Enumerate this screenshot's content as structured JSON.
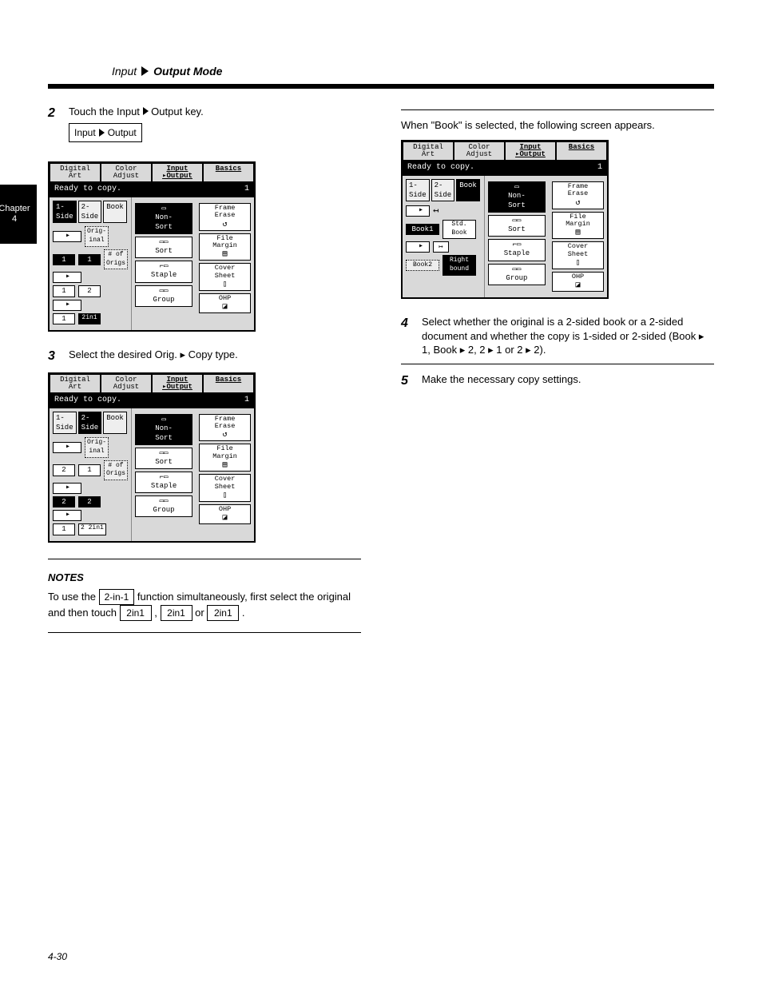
{
  "header": {
    "prefix": "Input",
    "suffix": "Output Mode"
  },
  "sidetab": {
    "line1": "Chapter",
    "line2": "4"
  },
  "left": {
    "step2": {
      "num": "2",
      "text": "Touch the",
      "tail": " key.",
      "key": "Output",
      "keyPrefix": "Input"
    },
    "panel1_caption": "",
    "step3": {
      "num": "3",
      "text": "Select the desired Orig. ▸ Copy type."
    },
    "noteHead": "NOTES",
    "note1a": "To use the ",
    "note1b": " function simulta­neously, first select the original and then touch ",
    "note1k1": "2-in-1",
    "note1k2": "2in1",
    "note1k3": "2in1",
    "note1c": ", ",
    "note1d": ".",
    "note1mid": " or "
  },
  "right": {
    "intro": "When \"Book\" is selected, the following screen appears.",
    "step4": {
      "num": "4",
      "text1": "Select whether the original is a 2-sided book or a 2-sided document and whether the copy is 1-sided or 2-sided (Book ▸ 1, Book ▸ 2, 2 ▸ 1 or 2 ▸ 2)."
    },
    "step5": {
      "num": "5",
      "text": "Make the necessary copy settings."
    }
  },
  "panels": {
    "tabs": [
      "Digital\nArt",
      "Color\nAdjust",
      "Input\n▸Output",
      "Basics"
    ],
    "status": "Ready to copy.",
    "count": "1",
    "subtabs": [
      "1-\nSide",
      "2-\nSide",
      "Book"
    ],
    "mids": [
      "Non-\nSort",
      "Sort",
      "Staple",
      "Group"
    ],
    "rights": [
      "Frame\nErase",
      "File\nMargin",
      "Cover\nSheet",
      "OHP"
    ],
    "p1_left_labels": [
      [
        "1",
        "1"
      ],
      [
        "1",
        "2"
      ],
      [
        "1",
        "2in1"
      ]
    ],
    "p1_small1": "Orig-\ninal",
    "p1_small2": "# of\nOrigs",
    "p2_left_labels": [
      [
        "2",
        "1"
      ],
      [
        "2",
        "2"
      ],
      [
        "1",
        "2 2in1"
      ]
    ],
    "p3_left": {
      "book1": "Book1",
      "stdbook": "Std.\nBook",
      "book2": "Book2",
      "rightbound": "Right\nbound"
    }
  },
  "page_number": "4-30"
}
